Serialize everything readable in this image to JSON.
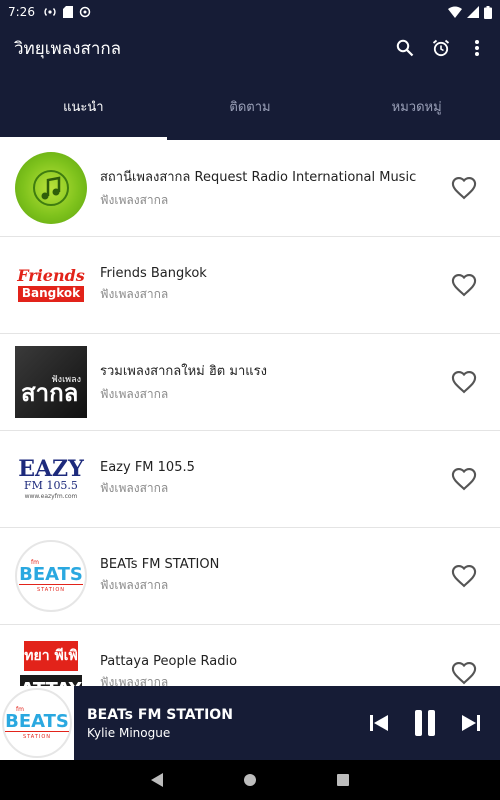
{
  "status": {
    "time": "7:26"
  },
  "app": {
    "title": "วิทยุเพลงสากล"
  },
  "tabs": [
    {
      "label": "แนะนำ",
      "active": true
    },
    {
      "label": "ติดตาม",
      "active": false
    },
    {
      "label": "หมวดหมู่",
      "active": false
    }
  ],
  "stations": [
    {
      "name": "สถานีเพลงสากล Request Radio International Music",
      "category": "ฟังเพลงสากล"
    },
    {
      "name": "Friends Bangkok",
      "category": "ฟังเพลงสากล",
      "logo": {
        "line1": "Friends",
        "line2": "Bangkok"
      }
    },
    {
      "name": "รวมเพลงสากลใหม่ ฮิต มาแรง",
      "category": "ฟังเพลงสากล",
      "logo": {
        "line1": "ฟังเพลง",
        "line2": "สากล"
      }
    },
    {
      "name": "Eazy FM 105.5",
      "category": "ฟังเพลงสากล",
      "logo": {
        "line1": "EAZY",
        "line2": "FM 105.5",
        "line3": "www.eazyfm.com"
      }
    },
    {
      "name": "BEATs FM STATION",
      "category": "ฟังเพลงสากล",
      "logo": {
        "line0": "fm",
        "line1": "BEATS",
        "line2": "STATION"
      }
    },
    {
      "name": "Pattaya People Radio",
      "category": "ฟังเพลงสากล",
      "logo": {
        "line1": "ทยา พีเพิ",
        "line2": "ATTAY"
      }
    }
  ],
  "player": {
    "title": "BEATs FM STATION",
    "artist": "Kylie Minogue",
    "logo": {
      "line0": "fm",
      "line1": "BEATS",
      "line2": "STATION"
    }
  },
  "colors": {
    "bar": "#161c36",
    "accent": "#ffffff",
    "heart": "#555555"
  },
  "icons": {
    "app_actions": [
      "search-icon",
      "alarm-icon",
      "more-vert-icon"
    ],
    "row_action": "heart-outline-icon",
    "player_controls": [
      "skip-previous-icon",
      "pause-icon",
      "skip-next-icon"
    ],
    "nav": [
      "back-icon",
      "home-icon",
      "recents-icon"
    ]
  }
}
